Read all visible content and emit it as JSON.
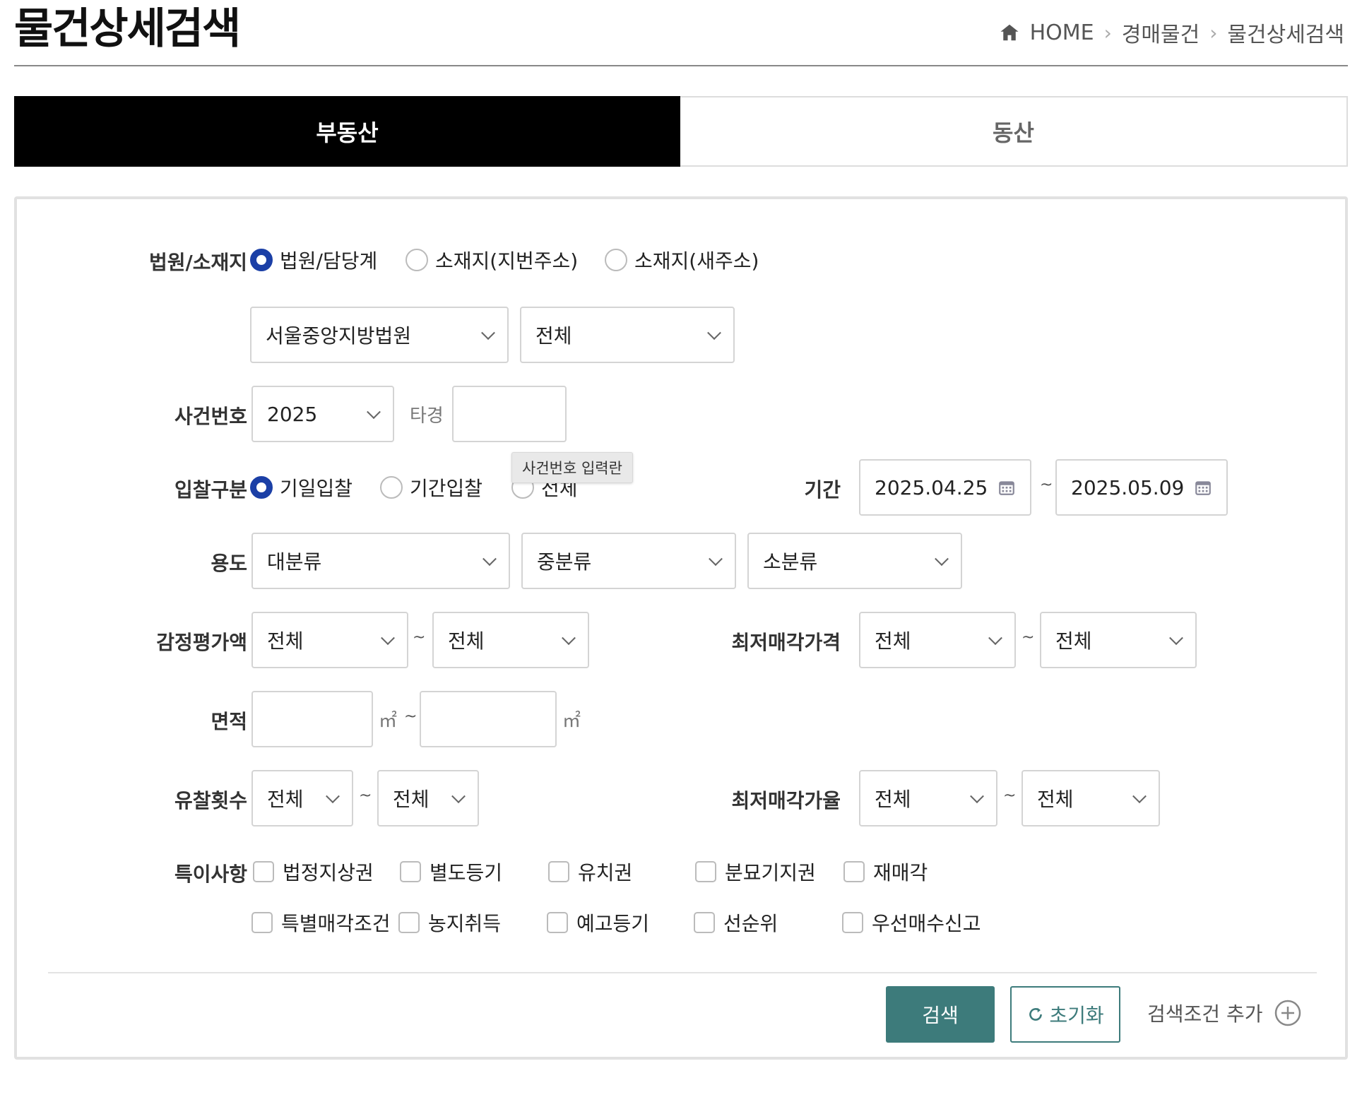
{
  "header": {
    "title": "물건상세검색",
    "breadcrumb": [
      "HOME",
      "경매물건",
      "물건상세검색"
    ]
  },
  "tabs": [
    {
      "label": "부동산",
      "active": true
    },
    {
      "label": "동산",
      "active": false
    }
  ],
  "form": {
    "court": {
      "label": "법원/소재지",
      "radios": [
        {
          "label": "법원/담당계",
          "checked": true
        },
        {
          "label": "소재지(지번주소)",
          "checked": false
        },
        {
          "label": "소재지(새주소)",
          "checked": false
        }
      ],
      "court_select": "서울중앙지방법원",
      "dept_select": "전체"
    },
    "case": {
      "label": "사건번호",
      "year_select": "2025",
      "type_text": "타경",
      "number_value": "",
      "tooltip": "사건번호 입력란"
    },
    "bid": {
      "label": "입찰구분",
      "radios": [
        {
          "label": "기일입찰",
          "checked": true
        },
        {
          "label": "기간입찰",
          "checked": false
        },
        {
          "label": "전체",
          "checked": false
        }
      ],
      "period_label": "기간",
      "date_from": "2025.04.25",
      "date_to": "2025.05.09",
      "tilde": "~"
    },
    "usage": {
      "label": "용도",
      "major": "대분류",
      "middle": "중분류",
      "minor": "소분류"
    },
    "appraisal": {
      "label": "감정평가액",
      "from": "전체",
      "to": "전체",
      "min_price_label": "최저매각가격",
      "min_price_from": "전체",
      "min_price_to": "전체"
    },
    "area": {
      "label": "면적",
      "from": "",
      "to": "",
      "unit": "㎡"
    },
    "fail_count": {
      "label": "유찰횟수",
      "from": "전체",
      "to": "전체",
      "min_rate_label": "최저매각가율",
      "min_rate_from": "전체",
      "min_rate_to": "전체"
    },
    "special": {
      "label": "특이사항",
      "row1": [
        "법정지상권",
        "별도등기",
        "유치권",
        "분묘기지권",
        "재매각"
      ],
      "row2": [
        "특별매각조건",
        "농지취득",
        "예고등기",
        "선순위",
        "우선매수신고"
      ]
    }
  },
  "actions": {
    "search": "검색",
    "reset": "초기화",
    "add_condition": "검색조건 추가"
  },
  "colors": {
    "accent": "#3d7b7b",
    "radio": "#1b3fa6",
    "tab_active": "#000000"
  }
}
